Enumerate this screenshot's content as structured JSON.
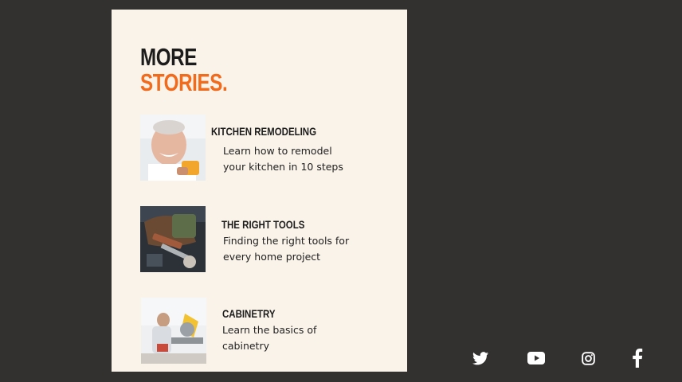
{
  "heading": {
    "line1": "MORE",
    "line2": "STORIES."
  },
  "stories": [
    {
      "title": "KITCHEN REMODELING",
      "description": "Learn how to remodel your kitchen in 10 steps"
    },
    {
      "title": "THE RIGHT TOOLS",
      "description": "Finding the right tools for every home project"
    },
    {
      "title": "CABINETRY",
      "description": "Learn the basics of cabinetry"
    }
  ],
  "social": [
    "twitter-icon",
    "youtube-icon",
    "instagram-icon",
    "facebook-icon"
  ],
  "colors": {
    "background": "#333130",
    "panel": "#faf3e9",
    "accent": "#f26a1b",
    "text": "#1c1c1c"
  }
}
